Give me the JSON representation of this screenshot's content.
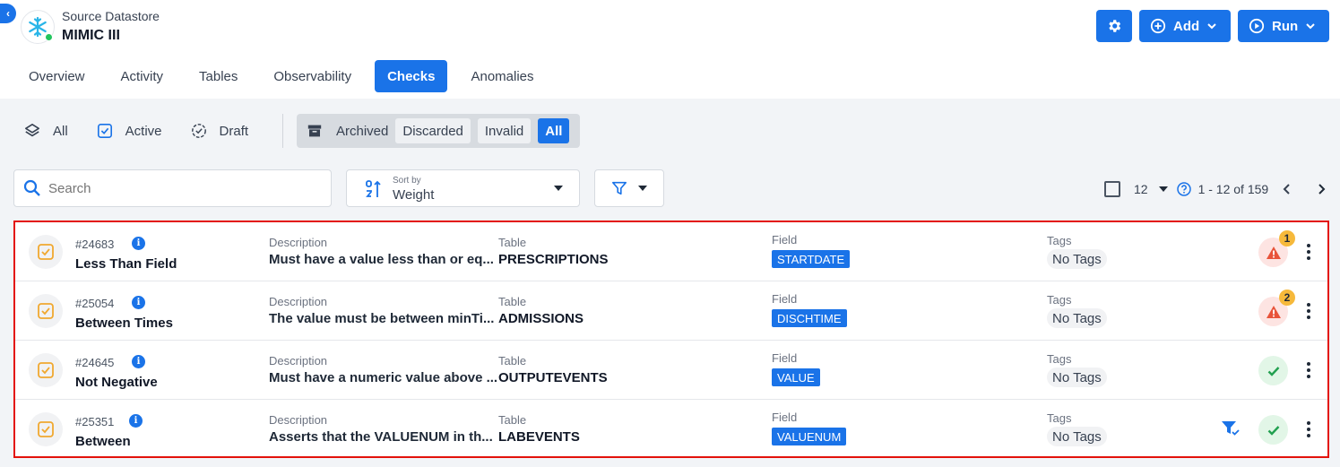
{
  "header": {
    "datastore_label": "Source Datastore",
    "datastore_name": "MIMIC III",
    "add_label": "Add",
    "run_label": "Run"
  },
  "tabs": [
    {
      "label": "Overview",
      "active": false
    },
    {
      "label": "Activity",
      "active": false
    },
    {
      "label": "Tables",
      "active": false
    },
    {
      "label": "Observability",
      "active": false
    },
    {
      "label": "Checks",
      "active": true
    },
    {
      "label": "Anomalies",
      "active": false
    }
  ],
  "status_filters": {
    "all": "All",
    "active": "Active",
    "draft": "Draft",
    "archived": "Archived",
    "discarded": "Discarded",
    "invalid": "Invalid",
    "all_selected": "All"
  },
  "toolbar": {
    "search_placeholder": "Search",
    "sort_label": "Sort by",
    "sort_value": "Weight"
  },
  "pagination": {
    "page_size": "12",
    "range": "1 - 12 of 159"
  },
  "labels": {
    "description": "Description",
    "table": "Table",
    "field": "Field",
    "tags": "Tags"
  },
  "checks": [
    {
      "id": "#24683",
      "name": "Less Than Field",
      "description": "Must have a value less than or eq...",
      "table": "PRESCRIPTIONS",
      "field": "STARTDATE",
      "tags": "No Tags",
      "status": "warning",
      "anomaly_count": "1",
      "filter_icon": false
    },
    {
      "id": "#25054",
      "name": "Between Times",
      "description": "The value must be between minTi...",
      "table": "ADMISSIONS",
      "field": "DISCHTIME",
      "tags": "No Tags",
      "status": "warning",
      "anomaly_count": "2",
      "filter_icon": false
    },
    {
      "id": "#24645",
      "name": "Not Negative",
      "description": "Must have a numeric value above ...",
      "table": "OUTPUTEVENTS",
      "field": "VALUE",
      "tags": "No Tags",
      "status": "ok",
      "anomaly_count": "",
      "filter_icon": false
    },
    {
      "id": "#25351",
      "name": "Between",
      "description": "Asserts that the VALUENUM in th...",
      "table": "LABEVENTS",
      "field": "VALUENUM",
      "tags": "No Tags",
      "status": "ok",
      "anomaly_count": "",
      "filter_icon": true
    }
  ],
  "colors": {
    "primary": "#1a73e8",
    "warning": "#e8533a",
    "success": "#22a050",
    "highlight_border": "#e3120b",
    "check_icon": "#f0a830"
  }
}
